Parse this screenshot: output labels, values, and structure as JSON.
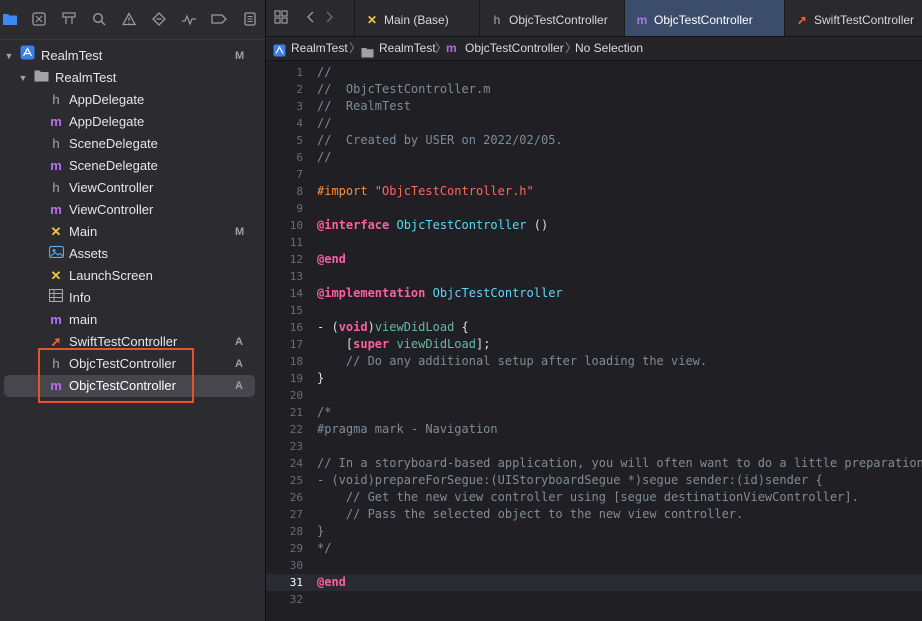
{
  "navigator": {
    "tree": [
      {
        "label": "RealmTest",
        "icon": "project-icon",
        "status": "M",
        "level": 0,
        "disclosure": "open"
      },
      {
        "label": "RealmTest",
        "icon": "folder-icon",
        "status": "",
        "level": 1,
        "disclosure": "open"
      },
      {
        "label": "AppDelegate",
        "icon": "header-file-icon",
        "status": "",
        "level": 2
      },
      {
        "label": "AppDelegate",
        "icon": "objc-file-icon",
        "status": "",
        "level": 2
      },
      {
        "label": "SceneDelegate",
        "icon": "header-file-icon",
        "status": "",
        "level": 2
      },
      {
        "label": "SceneDelegate",
        "icon": "objc-file-icon",
        "status": "",
        "level": 2
      },
      {
        "label": "ViewController",
        "icon": "header-file-icon",
        "status": "",
        "level": 2
      },
      {
        "label": "ViewController",
        "icon": "objc-file-icon",
        "status": "",
        "level": 2
      },
      {
        "label": "Main",
        "icon": "storyboard-icon",
        "status": "M",
        "level": 2
      },
      {
        "label": "Assets",
        "icon": "assets-icon",
        "status": "",
        "level": 2
      },
      {
        "label": "LaunchScreen",
        "icon": "storyboard-icon",
        "status": "",
        "level": 2
      },
      {
        "label": "Info",
        "icon": "plist-icon",
        "status": "",
        "level": 2
      },
      {
        "label": "main",
        "icon": "objc-file-icon",
        "status": "",
        "level": 2
      },
      {
        "label": "SwiftTestController",
        "icon": "swift-file-icon",
        "status": "A",
        "level": 2
      },
      {
        "label": "ObjcTestController",
        "icon": "header-file-icon",
        "status": "A",
        "level": 2
      },
      {
        "label": "ObjcTestController",
        "icon": "objc-file-icon",
        "status": "A",
        "level": 2,
        "selected": true
      }
    ]
  },
  "tabs": [
    {
      "label": "Main (Base)",
      "icon": "storyboard-icon"
    },
    {
      "label": "ObjcTestController",
      "icon": "header-file-icon"
    },
    {
      "label": "ObjcTestController",
      "icon": "objc-file-icon",
      "active": true
    },
    {
      "label": "SwiftTestController",
      "icon": "swift-file-icon"
    }
  ],
  "jumpbar": {
    "project": "RealmTest",
    "group": "RealmTest",
    "file": "ObjcTestController",
    "symbol": "No Selection"
  },
  "editor": {
    "current_line": 31,
    "lines": [
      [
        [
          "c",
          "//"
        ]
      ],
      [
        [
          "c",
          "//  ObjcTestController.m"
        ]
      ],
      [
        [
          "c",
          "//  RealmTest"
        ]
      ],
      [
        [
          "c",
          "//"
        ]
      ],
      [
        [
          "c",
          "//  Created by USER on 2022/02/05."
        ]
      ],
      [
        [
          "c",
          "//"
        ]
      ],
      [],
      [
        [
          "pp",
          "#import "
        ],
        [
          "s",
          "\"ObjcTestController.h\""
        ]
      ],
      [],
      [
        [
          "k",
          "@interface "
        ],
        [
          "t",
          "ObjcTestController"
        ],
        [
          "p",
          " ()"
        ]
      ],
      [],
      [
        [
          "k",
          "@end"
        ]
      ],
      [],
      [
        [
          "k",
          "@implementation "
        ],
        [
          "t",
          "ObjcTestController"
        ]
      ],
      [],
      [
        [
          "p",
          "- ("
        ],
        [
          "k",
          "void"
        ],
        [
          "p",
          ")"
        ],
        [
          "f",
          "viewDidLoad"
        ],
        [
          "p",
          " {"
        ]
      ],
      [
        [
          "p",
          "    ["
        ],
        [
          "k",
          "super"
        ],
        [
          "p",
          " "
        ],
        [
          "f",
          "viewDidLoad"
        ],
        [
          "p",
          "];"
        ]
      ],
      [
        [
          "c",
          "    // Do any additional setup after loading the view."
        ]
      ],
      [
        [
          "p",
          "}"
        ]
      ],
      [],
      [
        [
          "c",
          "/*"
        ]
      ],
      [
        [
          "c",
          "#pragma mark - Navigation"
        ]
      ],
      [],
      [
        [
          "c",
          "// In a storyboard-based application, you will often want to do a little preparation before navigation"
        ]
      ],
      [
        [
          "c",
          "- (void)prepareForSegue:(UIStoryboardSegue *)segue sender:(id)sender {"
        ]
      ],
      [
        [
          "c",
          "    // Get the new view controller using [segue destinationViewController]."
        ]
      ],
      [
        [
          "c",
          "    // Pass the selected object to the new view controller."
        ]
      ],
      [
        [
          "c",
          "}"
        ]
      ],
      [
        [
          "c",
          "*/"
        ]
      ],
      [],
      [
        [
          "k",
          "@end"
        ]
      ],
      []
    ]
  },
  "colors": {
    "accent": "#3b82f6",
    "highlight_box": "#e8522a",
    "active_tab": "#3b4d6a"
  }
}
